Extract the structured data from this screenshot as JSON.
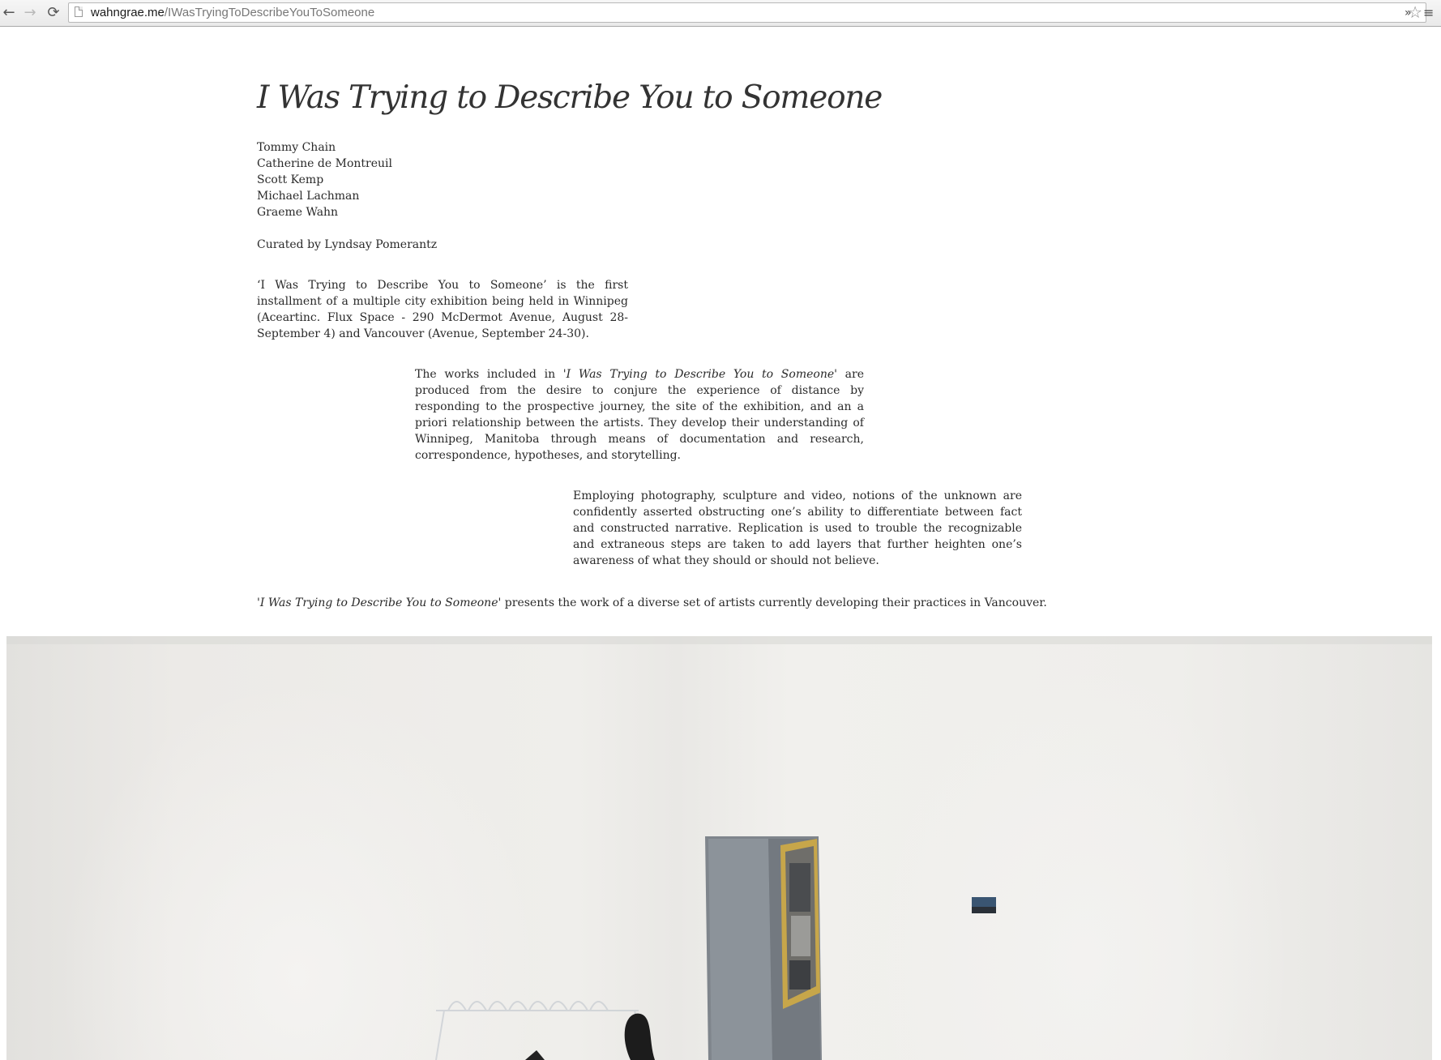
{
  "browser": {
    "url_host": "wahngrae.me",
    "url_path": "/IWasTryingToDescribeYouToSomeone",
    "icons": {
      "back": "back-arrow-icon",
      "forward": "forward-arrow-icon",
      "reload": "reload-icon",
      "page": "page-icon",
      "bookmark": "star-icon",
      "extensions": "chevron-double-icon",
      "menu": "hamburger-menu-icon"
    }
  },
  "page": {
    "title": "I Was Trying to Describe You to Someone",
    "artists": [
      "Tommy Chain",
      "Catherine de Montreuil",
      "Scott Kemp",
      "Michael Lachman",
      "Graeme Wahn"
    ],
    "curator": "Curated by Lyndsay Pomerantz",
    "intro": "‘I Was Trying to Describe You to Someone’ is the first installment of a multiple city exhibition being held in Winnipeg (Aceartinc. Flux Space - 290 McDermot Avenue, August 28-September 4) and Vancouver (Avenue, September 24-30).",
    "works": {
      "prefix": "The works included in '",
      "title": "I Was Trying to Describe You to Someone",
      "suffix": "' are produced from the desire to conjure the experience of distance by responding to the prospective journey, the site of the exhibition, and an a priori relationship between the artists. They develop their understanding of Winnipeg, Manitoba through means of documentation and research, correspondence, hypotheses, and storytelling."
    },
    "employing": "Employing photography, sculpture and video, notions of the unknown are confidently asserted obstructing one’s ability to differentiate between fact and constructed narrative. Replication is used to trouble the recognizable and extraneous steps are taken to add layers that further heighten one’s awareness of what they should or should not believe.",
    "closing": {
      "prefix": "'",
      "title": "I Was Trying to Describe You to Someone",
      "suffix": "' presents the work of a diverse set of artists currently developing their practices in Vancouver."
    }
  }
}
